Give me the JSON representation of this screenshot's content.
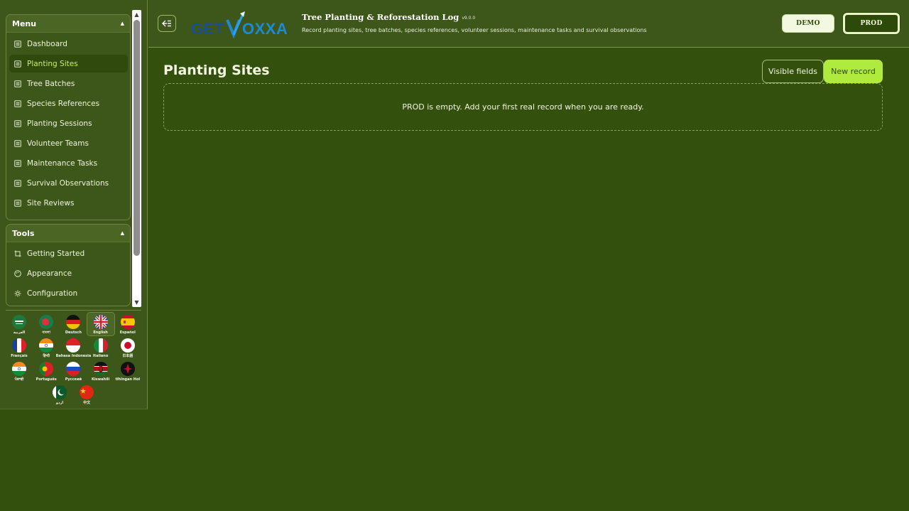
{
  "sidebar": {
    "menu_title": "Menu",
    "tools_title": "Tools",
    "menu_items": [
      {
        "label": "Dashboard",
        "active": false
      },
      {
        "label": "Planting Sites",
        "active": true
      },
      {
        "label": "Tree Batches",
        "active": false
      },
      {
        "label": "Species References",
        "active": false
      },
      {
        "label": "Planting Sessions",
        "active": false
      },
      {
        "label": "Volunteer Teams",
        "active": false
      },
      {
        "label": "Maintenance Tasks",
        "active": false
      },
      {
        "label": "Survival Observations",
        "active": false
      },
      {
        "label": "Site Reviews",
        "active": false
      }
    ],
    "tool_items": [
      {
        "label": "Getting Started",
        "icon": "crop-icon"
      },
      {
        "label": "Appearance",
        "icon": "palette-icon"
      },
      {
        "label": "Configuration",
        "icon": "gear-icon"
      }
    ]
  },
  "languages": [
    {
      "label": "العربية",
      "flag": "saudi-arabia-flag-icon",
      "selected": false
    },
    {
      "label": "বাংলা",
      "flag": "bangladesh-flag-icon",
      "selected": false
    },
    {
      "label": "Deutsch",
      "flag": "germany-flag-icon",
      "selected": false
    },
    {
      "label": "English",
      "flag": "uk-flag-icon",
      "selected": true
    },
    {
      "label": "Español",
      "flag": "spain-flag-icon",
      "selected": false
    },
    {
      "label": "Français",
      "flag": "france-flag-icon",
      "selected": false
    },
    {
      "label": "हिन्दी",
      "flag": "india-flag-icon",
      "selected": false
    },
    {
      "label": "Bahasa Indonesia",
      "flag": "indonesia-flag-icon",
      "selected": false
    },
    {
      "label": "Italiano",
      "flag": "italy-flag-icon",
      "selected": false
    },
    {
      "label": "日本語",
      "flag": "japan-flag-icon",
      "selected": false
    },
    {
      "label": "ਪੰਜਾਬੀ",
      "flag": "india-flag-icon",
      "selected": false
    },
    {
      "label": "Português",
      "flag": "portugal-flag-icon",
      "selected": false
    },
    {
      "label": "Русский",
      "flag": "russia-flag-icon",
      "selected": false
    },
    {
      "label": "Kiswahili",
      "flag": "kenya-flag-icon",
      "selected": false
    },
    {
      "label": "tlhIngan Hol",
      "flag": "klingon-flag-icon",
      "selected": false
    },
    {
      "label": "اردو",
      "flag": "pakistan-flag-icon",
      "selected": false
    },
    {
      "label": "中文",
      "flag": "china-flag-icon",
      "selected": false
    }
  ],
  "header": {
    "logo_text": "GETVOXXA",
    "app_title": "Tree Planting & Reforestation Log",
    "version": "v9.0.0",
    "subtitle": "Record planting sites, tree batches, species references, volunteer sessions, maintenance tasks and survival observations",
    "env_demo": "DEMO",
    "env_prod": "PROD",
    "active_env": "PROD"
  },
  "main": {
    "page_title": "Planting Sites",
    "visible_fields_label": "Visible fields",
    "new_record_label": "New record",
    "empty_message": "PROD is empty. Add your first real record when you are ready."
  },
  "colors": {
    "background": "#34500d",
    "panel": "#3d561a",
    "accent": "#b1ea3f",
    "active_text": "#c8f06a"
  }
}
